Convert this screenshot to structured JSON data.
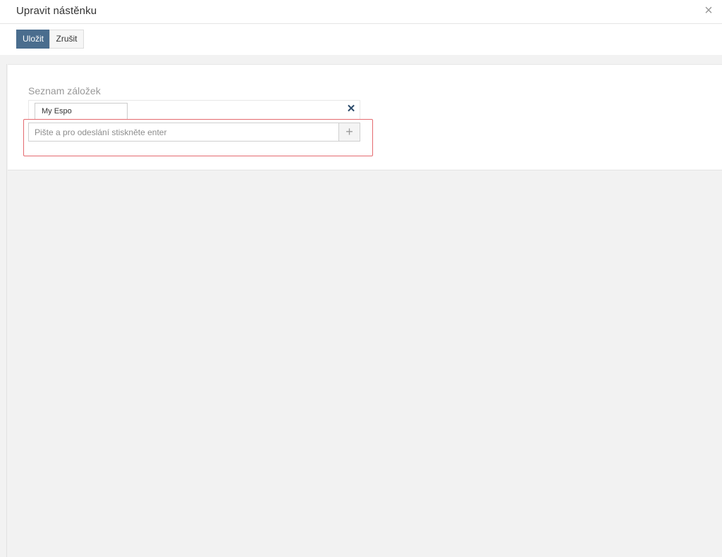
{
  "header": {
    "title": "Upravit nástěnku",
    "close_glyph": "×"
  },
  "toolbar": {
    "save_label": "Uložit",
    "cancel_label": "Zrušit"
  },
  "form": {
    "tabs_label": "Seznam záložek",
    "tabs": [
      {
        "label": "My Espo"
      }
    ],
    "remove_glyph": "✕",
    "new_tab_placeholder": "Pište a pro odeslání stiskněte enter",
    "add_glyph": "+"
  },
  "colors": {
    "primary_button": "#4a6d8e",
    "highlight": "#e46a6f",
    "remove_icon": "#2c4b6b"
  },
  "icons": {
    "close": "close-icon",
    "remove": "remove-icon",
    "add": "plus-icon"
  }
}
